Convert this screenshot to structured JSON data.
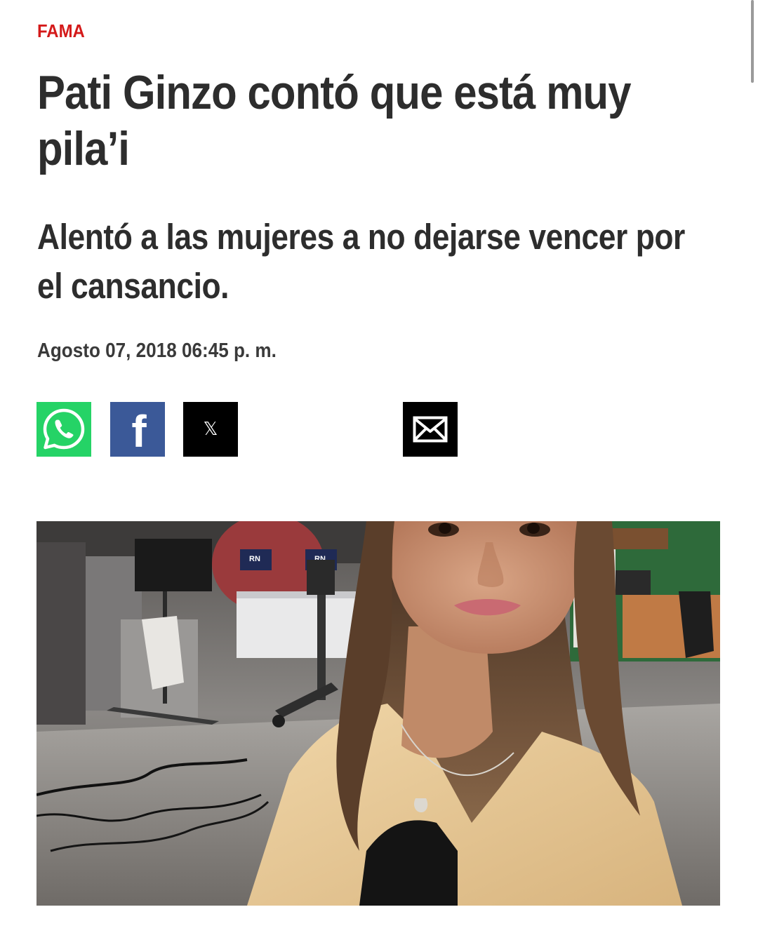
{
  "article": {
    "section": "FAMA",
    "headline": "Pati Ginzo contó que está muy pila’i",
    "subtitle": "Alentó a las mujeres a no dejarse vencer por el cansancio.",
    "date": "Agosto 07, 2018 06:45 p. m."
  },
  "share": {
    "buttons": [
      {
        "name": "whatsapp",
        "icon": "whatsapp-icon",
        "color": "#25d366"
      },
      {
        "name": "facebook",
        "icon": "facebook-icon",
        "glyph": "f",
        "color": "#3b5998"
      },
      {
        "name": "x",
        "icon": "x-icon",
        "glyph": "𝕏",
        "color": "#000000"
      },
      {
        "name": "email",
        "icon": "envelope-icon",
        "color": "#000000"
      }
    ]
  },
  "hero_image": {
    "logo_text": "RN"
  },
  "colors": {
    "section_label": "#d41a1a",
    "text": "#2d2d2d",
    "background": "#ffffff"
  }
}
